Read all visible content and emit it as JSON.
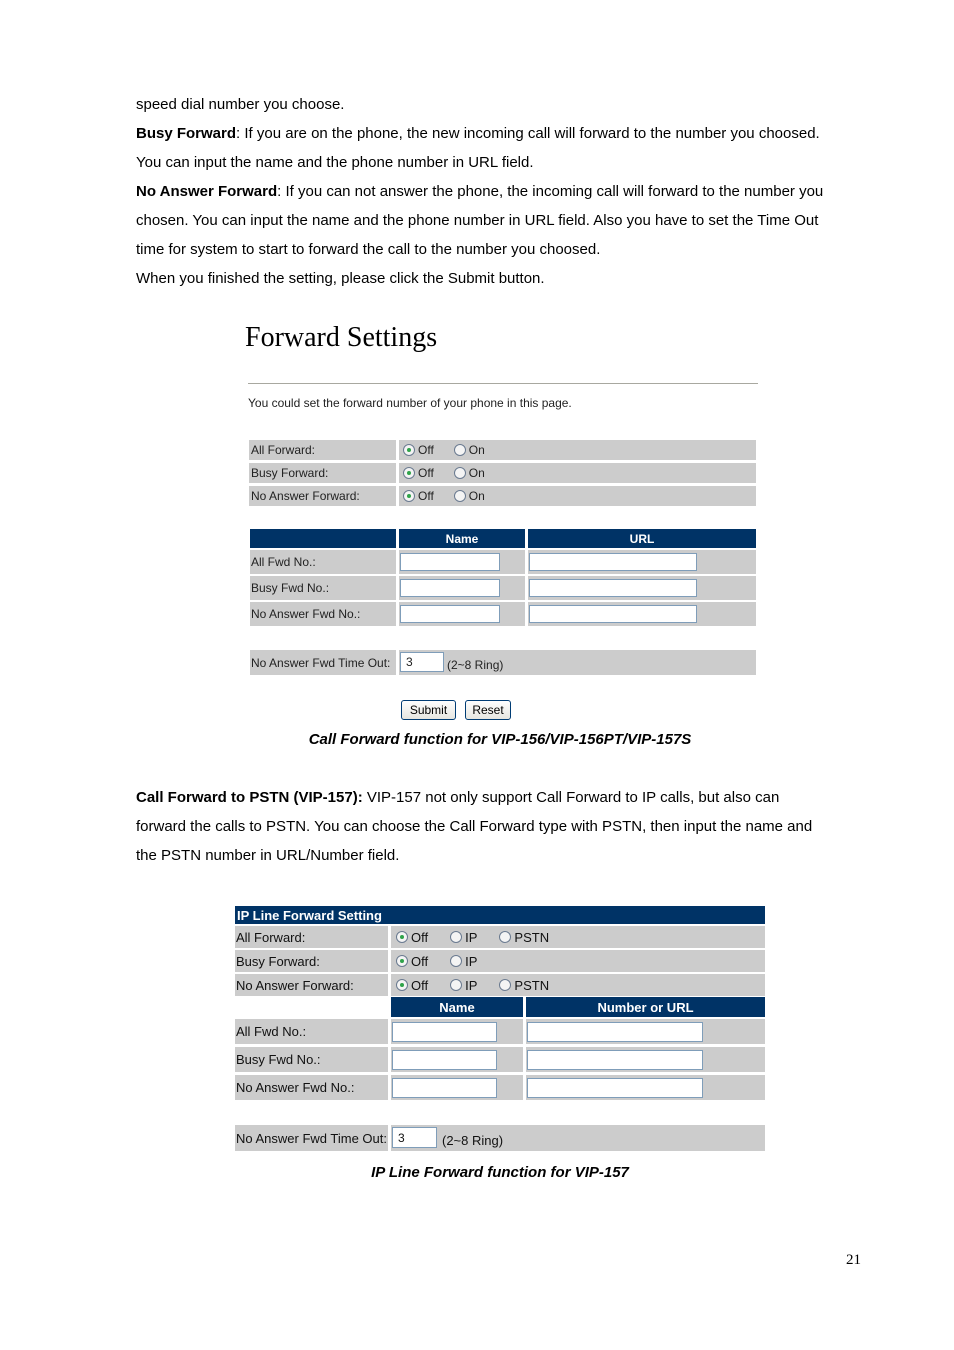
{
  "paragraphs": {
    "p1": "speed dial number you choose.",
    "p2_bold": "Busy Forward",
    "p2_rest": ": If you are on the phone, the new incoming call will forward to the number you choosed.",
    "p3": "You can input the name and the phone number in URL field.",
    "p4_bold": "No Answer Forward",
    "p4_rest": ": If you can not answer the phone, the incoming call will forward to the number you",
    "p5": "chosen. You can input the name and the phone number in URL field. Also you have to set the Time Out",
    "p6": "time for system to start to forward the call to the number you choosed.",
    "p7": "When you finished the setting, please click the Submit button.",
    "pstn_bold": "Call Forward to PSTN (VIP-157):",
    "pstn_l1": " VIP-157 not only support Call Forward to IP calls, but also can",
    "pstn_l2": "forward the calls to PSTN. You can choose the Call Forward type with PSTN, then input the name and",
    "pstn_l3": "the PSTN number in URL/Number field."
  },
  "forward_settings": {
    "title": "Forward Settings",
    "intro": "You could set the forward number of your phone in this page.",
    "modes": [
      {
        "label": "All Forward:",
        "options": [
          "Off",
          "On"
        ],
        "selected": "Off"
      },
      {
        "label": "Busy Forward:",
        "options": [
          "Off",
          "On"
        ],
        "selected": "Off"
      },
      {
        "label": "No Answer Forward:",
        "options": [
          "Off",
          "On"
        ],
        "selected": "Off"
      }
    ],
    "columns": [
      "Name",
      "URL"
    ],
    "numbers": [
      {
        "label": "All Fwd No.:",
        "name": "",
        "url": ""
      },
      {
        "label": "Busy Fwd No.:",
        "name": "",
        "url": ""
      },
      {
        "label": "No Answer Fwd No.:",
        "name": "",
        "url": ""
      }
    ],
    "timeout_label": "No Answer Fwd Time Out:",
    "timeout_value": "3",
    "timeout_hint": "(2~8 Ring)",
    "submit_label": "Submit",
    "reset_label": "Reset",
    "caption": "Call Forward function for VIP-156/VIP-156PT/VIP-157S"
  },
  "ip_line": {
    "title": "IP Line Forward Setting",
    "modes": [
      {
        "label": "All Forward:",
        "options": [
          "Off",
          "IP",
          "PSTN"
        ],
        "selected": "Off"
      },
      {
        "label": "Busy Forward:",
        "options": [
          "Off",
          "IP"
        ],
        "selected": "Off"
      },
      {
        "label": "No Answer Forward:",
        "options": [
          "Off",
          "IP",
          "PSTN"
        ],
        "selected": "Off"
      }
    ],
    "columns": [
      "Name",
      "Number or URL"
    ],
    "numbers": [
      {
        "label": "All Fwd No.:",
        "name": "",
        "url": ""
      },
      {
        "label": "Busy Fwd No.:",
        "name": "",
        "url": ""
      },
      {
        "label": "No Answer Fwd No.:",
        "name": "",
        "url": ""
      }
    ],
    "timeout_label": "No Answer Fwd Time Out:",
    "timeout_value": "3",
    "timeout_hint": "(2~8 Ring)",
    "caption": "IP Line Forward function for VIP-157"
  },
  "page_number": "21",
  "colors": {
    "header_bg": "#003366",
    "row_bg": "#cccccc",
    "radio_dot": "#2fa34a"
  }
}
